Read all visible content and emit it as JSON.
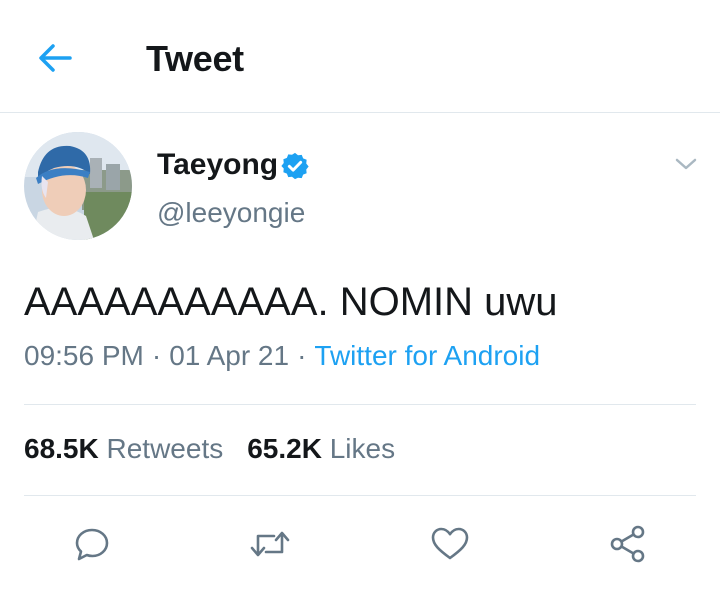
{
  "header": {
    "title": "Tweet"
  },
  "tweet": {
    "author": {
      "name": "Taeyong",
      "handle": "@leeyongie",
      "verified": true
    },
    "text": "AAAAAAAAAAA. NOMIN uwu",
    "time": "09:56 PM",
    "separator": "·",
    "date": "01 Apr 21",
    "source": "Twitter for Android"
  },
  "stats": {
    "retweets_count": "68.5K",
    "retweets_label": "Retweets",
    "likes_count": "65.2K",
    "likes_label": "Likes"
  },
  "icons": {
    "back": "arrow-left-icon",
    "verified": "verified-badge-icon",
    "caret": "chevron-down-icon",
    "reply": "reply-icon",
    "retweet": "retweet-icon",
    "like": "heart-icon",
    "share": "share-icon"
  },
  "colors": {
    "accent": "#1da1f2",
    "text": "#14171a",
    "secondary": "#657786",
    "divider": "#e1e8ed"
  }
}
